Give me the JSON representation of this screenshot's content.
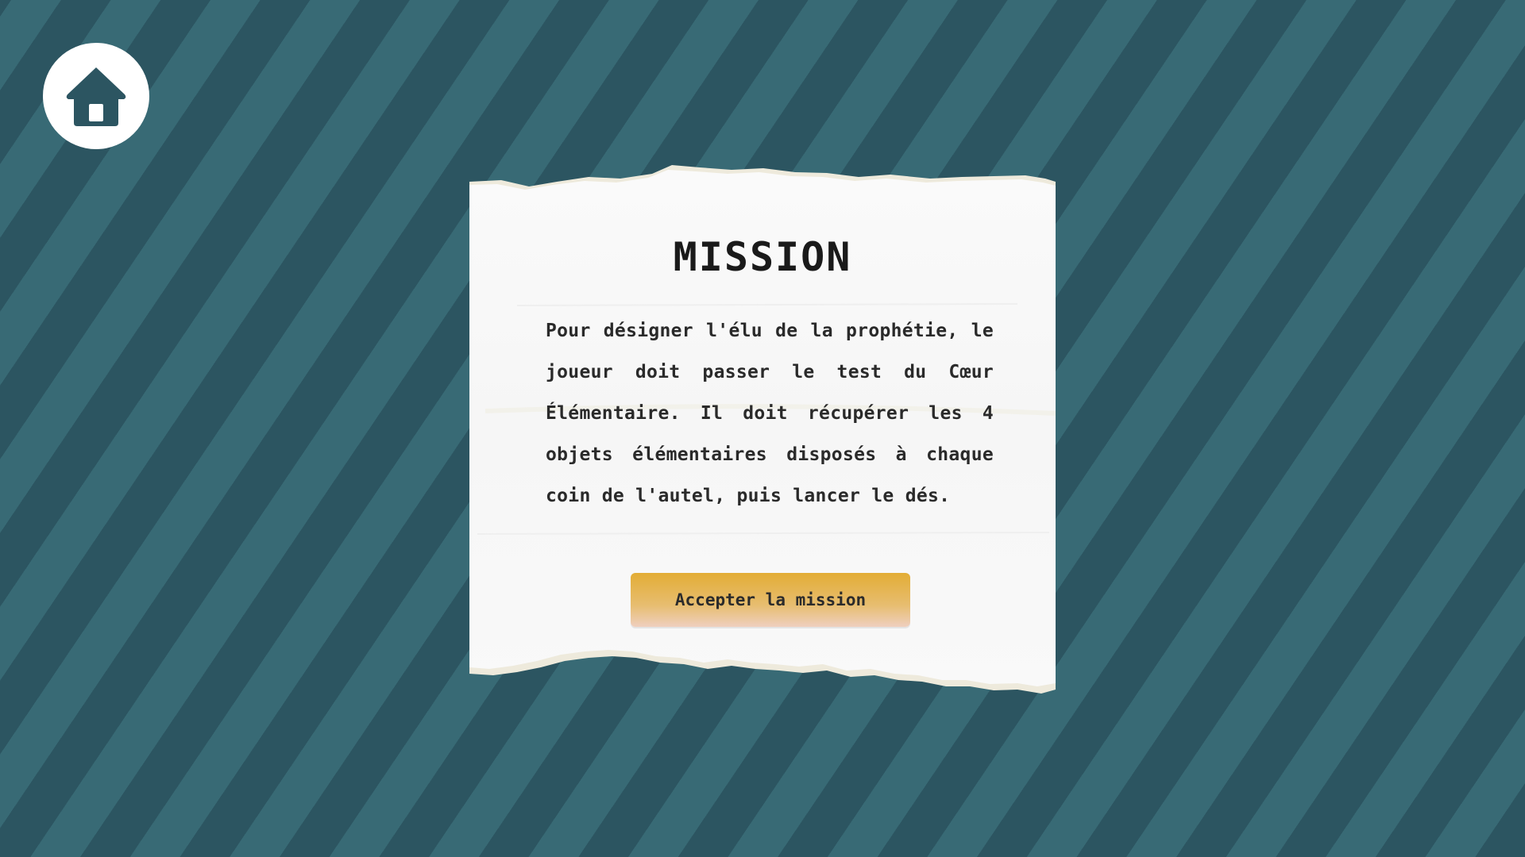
{
  "colors": {
    "stripe_dark": "#2c5561",
    "stripe_light": "#386a75",
    "paper": "#f8f8f8",
    "button_gold": "#e3ad35",
    "button_pink": "#efcfbf",
    "home_icon": "#2c5561"
  },
  "nav": {
    "home_icon": "house-icon"
  },
  "mission": {
    "title": "MISSION",
    "text": "Pour désigner l'élu de la prophétie, le joueur doit passer le test du Cœur Élémentaire. Il doit récupérer les 4 objets élémentaires disposés à chaque coin de l'autel, puis lancer le dés.",
    "accept_label": "Accepter la mission"
  }
}
